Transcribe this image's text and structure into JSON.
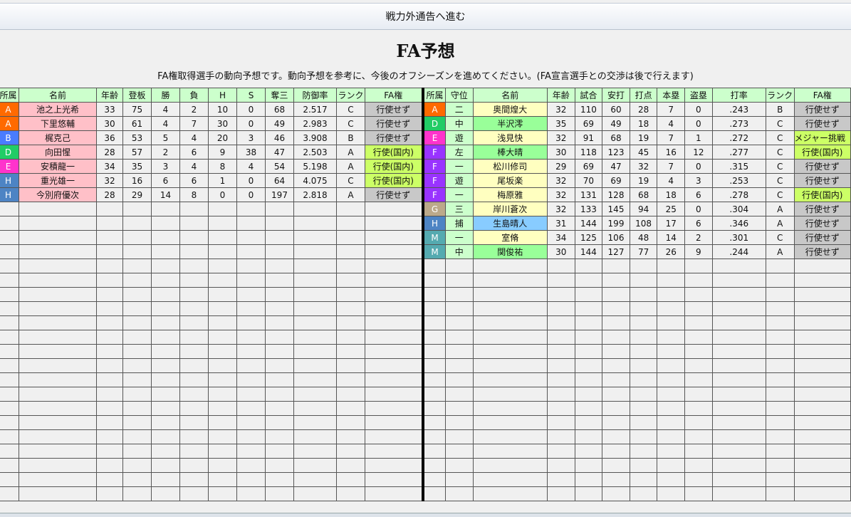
{
  "header": {
    "button_label": "戦力外通告へ進む"
  },
  "page": {
    "title": "FA予想",
    "description": "FA権取得選手の動向予想です。動向予想を参考に、今後のオフシーズンを進めてください。(FA宣言選手との交渉は後で行えます)"
  },
  "colors": {
    "A": "#ff6a00",
    "B": "#4a7cff",
    "D": "#22cc66",
    "E": "#ff33cc",
    "F": "#9933ff",
    "G": "#bca98a",
    "H": "#4d84c4",
    "M": "#55aab0",
    "name_pitcher": "#ffc0c8",
    "name_batter_yellow": "#ffffc0",
    "name_batter_green": "#99ff99",
    "name_batter_blue": "#88ccff",
    "fa_no": "#c8c8c8",
    "fa_yes": "#ccff66",
    "header_bg": "#ccffcc"
  },
  "pitchers": {
    "headers": [
      "所属",
      "名前",
      "年齢",
      "登板",
      "勝",
      "負",
      "H",
      "S",
      "奪三",
      "防御率",
      "ランク",
      "FA権"
    ],
    "rows": [
      {
        "team": "A",
        "name": "池之上光希",
        "age": "33",
        "games": "75",
        "w": "4",
        "l": "2",
        "h": "10",
        "s": "0",
        "k": "68",
        "era": "2.517",
        "rank": "C",
        "fa": "行使せず"
      },
      {
        "team": "A",
        "name": "下里悠輔",
        "age": "30",
        "games": "61",
        "w": "4",
        "l": "7",
        "h": "30",
        "s": "0",
        "k": "49",
        "era": "2.983",
        "rank": "C",
        "fa": "行使せず"
      },
      {
        "team": "B",
        "name": "梶克己",
        "age": "36",
        "games": "53",
        "w": "5",
        "l": "4",
        "h": "20",
        "s": "3",
        "k": "46",
        "era": "3.908",
        "rank": "B",
        "fa": "行使せず"
      },
      {
        "team": "D",
        "name": "向田惺",
        "age": "28",
        "games": "57",
        "w": "2",
        "l": "6",
        "h": "9",
        "s": "38",
        "k": "47",
        "era": "2.503",
        "rank": "A",
        "fa": "行使(国内)"
      },
      {
        "team": "E",
        "name": "安積龍一",
        "age": "34",
        "games": "35",
        "w": "3",
        "l": "4",
        "h": "8",
        "s": "4",
        "k": "54",
        "era": "5.198",
        "rank": "A",
        "fa": "行使(国内)"
      },
      {
        "team": "H",
        "name": "重光雄一",
        "age": "32",
        "games": "16",
        "w": "6",
        "l": "6",
        "h": "1",
        "s": "0",
        "k": "64",
        "era": "4.075",
        "rank": "C",
        "fa": "行使(国内)"
      },
      {
        "team": "H",
        "name": "今別府優次",
        "age": "28",
        "games": "29",
        "w": "14",
        "l": "8",
        "h": "0",
        "s": "0",
        "k": "197",
        "era": "2.818",
        "rank": "A",
        "fa": "行使せず"
      }
    ]
  },
  "batters": {
    "headers": [
      "所属",
      "守位",
      "名前",
      "年齢",
      "試合",
      "安打",
      "打点",
      "本塁",
      "盗塁",
      "打率",
      "ランク",
      "FA権"
    ],
    "rows": [
      {
        "team": "A",
        "pos": "二",
        "name": "奥間煌大",
        "name_color": "yellow",
        "age": "32",
        "games": "110",
        "hits": "60",
        "rbi": "28",
        "hr": "7",
        "sb": "0",
        "avg": ".243",
        "rank": "B",
        "fa": "行使せず"
      },
      {
        "team": "D",
        "pos": "中",
        "name": "半沢澪",
        "name_color": "green",
        "age": "35",
        "games": "69",
        "hits": "49",
        "rbi": "18",
        "hr": "4",
        "sb": "0",
        "avg": ".273",
        "rank": "C",
        "fa": "行使せず"
      },
      {
        "team": "E",
        "pos": "遊",
        "name": "浅見快",
        "name_color": "yellow",
        "age": "32",
        "games": "91",
        "hits": "68",
        "rbi": "19",
        "hr": "7",
        "sb": "1",
        "avg": ".272",
        "rank": "C",
        "fa": "メジャー挑戦"
      },
      {
        "team": "F",
        "pos": "左",
        "name": "棒大晴",
        "name_color": "green",
        "age": "30",
        "games": "118",
        "hits": "123",
        "rbi": "45",
        "hr": "16",
        "sb": "12",
        "avg": ".277",
        "rank": "C",
        "fa": "行使(国内)"
      },
      {
        "team": "F",
        "pos": "一",
        "name": "松川修司",
        "name_color": "yellow",
        "age": "29",
        "games": "69",
        "hits": "47",
        "rbi": "32",
        "hr": "7",
        "sb": "0",
        "avg": ".315",
        "rank": "C",
        "fa": "行使せず"
      },
      {
        "team": "F",
        "pos": "遊",
        "name": "尾坂楽",
        "name_color": "yellow",
        "age": "32",
        "games": "70",
        "hits": "69",
        "rbi": "19",
        "hr": "4",
        "sb": "3",
        "avg": ".253",
        "rank": "C",
        "fa": "行使せず"
      },
      {
        "team": "F",
        "pos": "一",
        "name": "梅原雅",
        "name_color": "yellow",
        "age": "32",
        "games": "131",
        "hits": "128",
        "rbi": "68",
        "hr": "18",
        "sb": "6",
        "avg": ".278",
        "rank": "C",
        "fa": "行使(国内)"
      },
      {
        "team": "G",
        "pos": "三",
        "name": "岸川蒼次",
        "name_color": "yellow",
        "age": "32",
        "games": "133",
        "hits": "145",
        "rbi": "94",
        "hr": "25",
        "sb": "0",
        "avg": ".304",
        "rank": "A",
        "fa": "行使せず"
      },
      {
        "team": "H",
        "pos": "捕",
        "name": "生島晴人",
        "name_color": "blue",
        "age": "31",
        "games": "144",
        "hits": "199",
        "rbi": "108",
        "hr": "17",
        "sb": "6",
        "avg": ".346",
        "rank": "A",
        "fa": "行使せず"
      },
      {
        "team": "M",
        "pos": "一",
        "name": "室脩",
        "name_color": "yellow",
        "age": "34",
        "games": "125",
        "hits": "106",
        "rbi": "48",
        "hr": "14",
        "sb": "2",
        "avg": ".301",
        "rank": "C",
        "fa": "行使せず"
      },
      {
        "team": "M",
        "pos": "中",
        "name": "関俊祐",
        "name_color": "green",
        "age": "30",
        "games": "144",
        "hits": "127",
        "rbi": "77",
        "hr": "26",
        "sb": "9",
        "avg": ".244",
        "rank": "A",
        "fa": "行使せず"
      }
    ]
  }
}
